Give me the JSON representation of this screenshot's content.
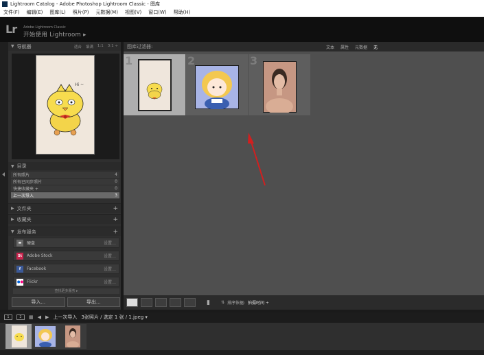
{
  "window": {
    "title": "Lightroom Catalog - Adobe Photoshop Lightroom Classic - 图库"
  },
  "menu": [
    "文件(F)",
    "编辑(E)",
    "图库(L)",
    "照片(P)",
    "元数据(M)",
    "视图(V)",
    "窗口(W)",
    "帮助(H)"
  ],
  "identity": {
    "logo": "Lr",
    "product": "Adobe Lightroom Classic",
    "message": "开始使用 Lightroom ▸"
  },
  "navigator": {
    "title": "导航器",
    "zoom": [
      "适合",
      "填满",
      "1:1",
      "3:1 ÷"
    ]
  },
  "catalog": {
    "title": "目录",
    "items": [
      {
        "label": "所有照片",
        "count": "4"
      },
      {
        "label": "所有已同步照片",
        "count": "0"
      },
      {
        "label": "快捷收藏夹 +",
        "count": "0"
      },
      {
        "label": "上一次导入",
        "count": "3"
      }
    ]
  },
  "sections": {
    "folders": "文件夹",
    "collections": "收藏夹",
    "publish": "发布服务"
  },
  "services": [
    {
      "label": "硬盘",
      "status": "设置…",
      "icon": "hard-drive-icon",
      "color": "#666666"
    },
    {
      "label": "Adobe Stock",
      "status": "设置…",
      "icon": "adobe-stock-icon",
      "color": "#c9254e"
    },
    {
      "label": "Facebook",
      "status": "设置…",
      "icon": "facebook-icon",
      "color": "#3b5998"
    },
    {
      "label": "Flickr",
      "status": "设置…",
      "icon": "flickr-icon",
      "color": "#ffffff"
    }
  ],
  "services_more": "查找更多服务 ▸",
  "buttons": {
    "import": "导入...",
    "export": "导出..."
  },
  "filter": {
    "title": "图库过滤器:",
    "options": [
      "文本",
      "属性",
      "元数据",
      "无"
    ]
  },
  "grid": {
    "cells": [
      {
        "num": "1"
      },
      {
        "num": "2"
      },
      {
        "num": "3"
      }
    ]
  },
  "toolbar": {
    "sort_label": "排序依据:",
    "sort_value": "拍摄时间 ÷"
  },
  "filmstrip": {
    "page1": "1",
    "page2": "2",
    "source": "上一次导入",
    "summary": "3张照片 / 选定 1 张 / 1.jpeg ▾"
  },
  "colors": {
    "arrow": "#d21f1f"
  }
}
